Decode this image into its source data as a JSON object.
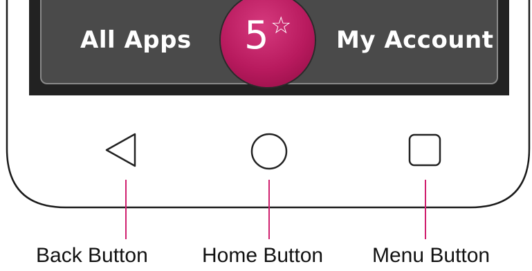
{
  "app_bar": {
    "left_label": "All Apps",
    "right_label": "My Account",
    "badge_number": "5",
    "badge_star": "☆"
  },
  "nav_buttons": [
    {
      "icon": "back-triangle-icon",
      "caption": "Back Button"
    },
    {
      "icon": "home-circle-icon",
      "caption": "Home Button"
    },
    {
      "icon": "menu-square-icon",
      "caption": "Menu Button"
    }
  ],
  "colors": {
    "badge": "#b81a5e",
    "leader_line": "#d01f6e",
    "app_bar": "#4a4a4a",
    "device_outline": "#1a1a1a"
  }
}
